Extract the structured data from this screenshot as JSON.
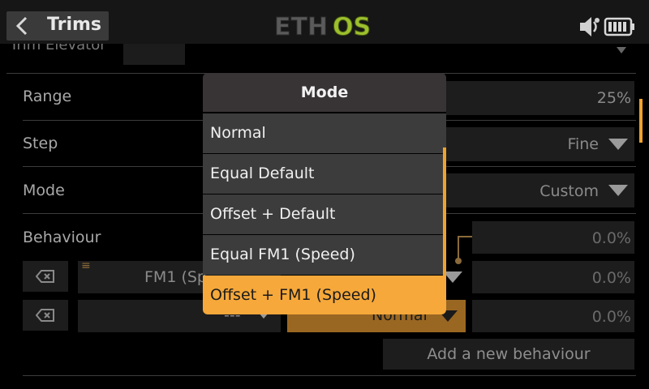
{
  "header": {
    "back_icon": "chevron-left-icon",
    "title": "Trims",
    "logo_eth": "ETH",
    "logo_os": "OS",
    "status_icons": [
      "sound-icon",
      "battery-icon"
    ],
    "colors": {
      "logo_gray": "#5a5a5a",
      "logo_green": "#9cbf2e"
    }
  },
  "page": {
    "trim_label_partial": "Trim Elevator",
    "rows": {
      "range": {
        "label": "Range",
        "value": "25%"
      },
      "step": {
        "label": "Step",
        "value": "Fine"
      },
      "mode": {
        "label": "Mode",
        "value": "Custom"
      },
      "behaviour": {
        "label": "Behaviour"
      }
    },
    "behaviour_rows": [
      {
        "flight_mode": "FM1 (Sp",
        "value": "0.0%"
      },
      {
        "flight_mode": "---",
        "mode": "Normal",
        "value": "0.0%"
      }
    ],
    "behaviour_header_value": "0.0%",
    "add_behaviour": "Add a new behaviour"
  },
  "dialog": {
    "title": "Mode",
    "options": [
      "Normal",
      "Equal Default",
      "Offset + Default",
      "Equal FM1 (Speed)",
      "Offset + FM1 (Speed)"
    ],
    "selected_index": 4,
    "accent_color": "#f6a83a"
  }
}
